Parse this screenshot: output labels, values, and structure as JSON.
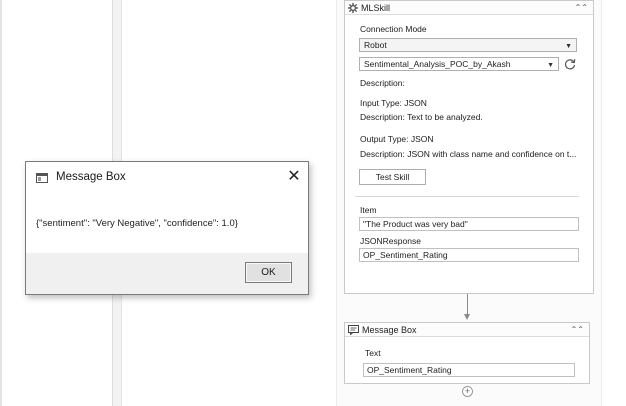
{
  "designer": {
    "mlskill": {
      "title": "MLSkill",
      "connection_mode_label": "Connection Mode",
      "connection_mode_value": "Robot",
      "skill_value": "Sentimental_Analysis_POC_by_Akash",
      "description_label": "Description:",
      "input_type_text": "Input Type: JSON",
      "input_description_text": "Description: Text to be analyzed.",
      "output_type_text": "Output Type: JSON",
      "output_description_text": "Description: JSON with class name and confidence on t...",
      "test_skill_label": "Test Skill",
      "item_label": "Item",
      "item_value": "\"The Product was very bad\"",
      "json_response_label": "JSONResponse",
      "json_response_value": "OP_Sentiment_Rating"
    },
    "message_box_activity": {
      "title": "Message Box",
      "text_label": "Text",
      "text_value": "OP_Sentiment_Rating"
    },
    "add_activity_symbol": "+"
  },
  "dialog": {
    "title": "Message Box",
    "close_symbol": "✕",
    "message": "{\"sentiment\": \"Very Negative\", \"confidence\": 1.0}",
    "ok_label": "OK"
  },
  "icons": {
    "mlskill_icon": "gear-icon",
    "message_box_icon": "speech-bubble-icon",
    "collapse": "double-chevron-up-icon",
    "refresh": "refresh-icon",
    "dialog_app": "window-icon"
  },
  "colors": {
    "dialog_footer": "#f0f0f0",
    "panel_border": "#c9c9c9",
    "connector": "#8a8a8a"
  }
}
